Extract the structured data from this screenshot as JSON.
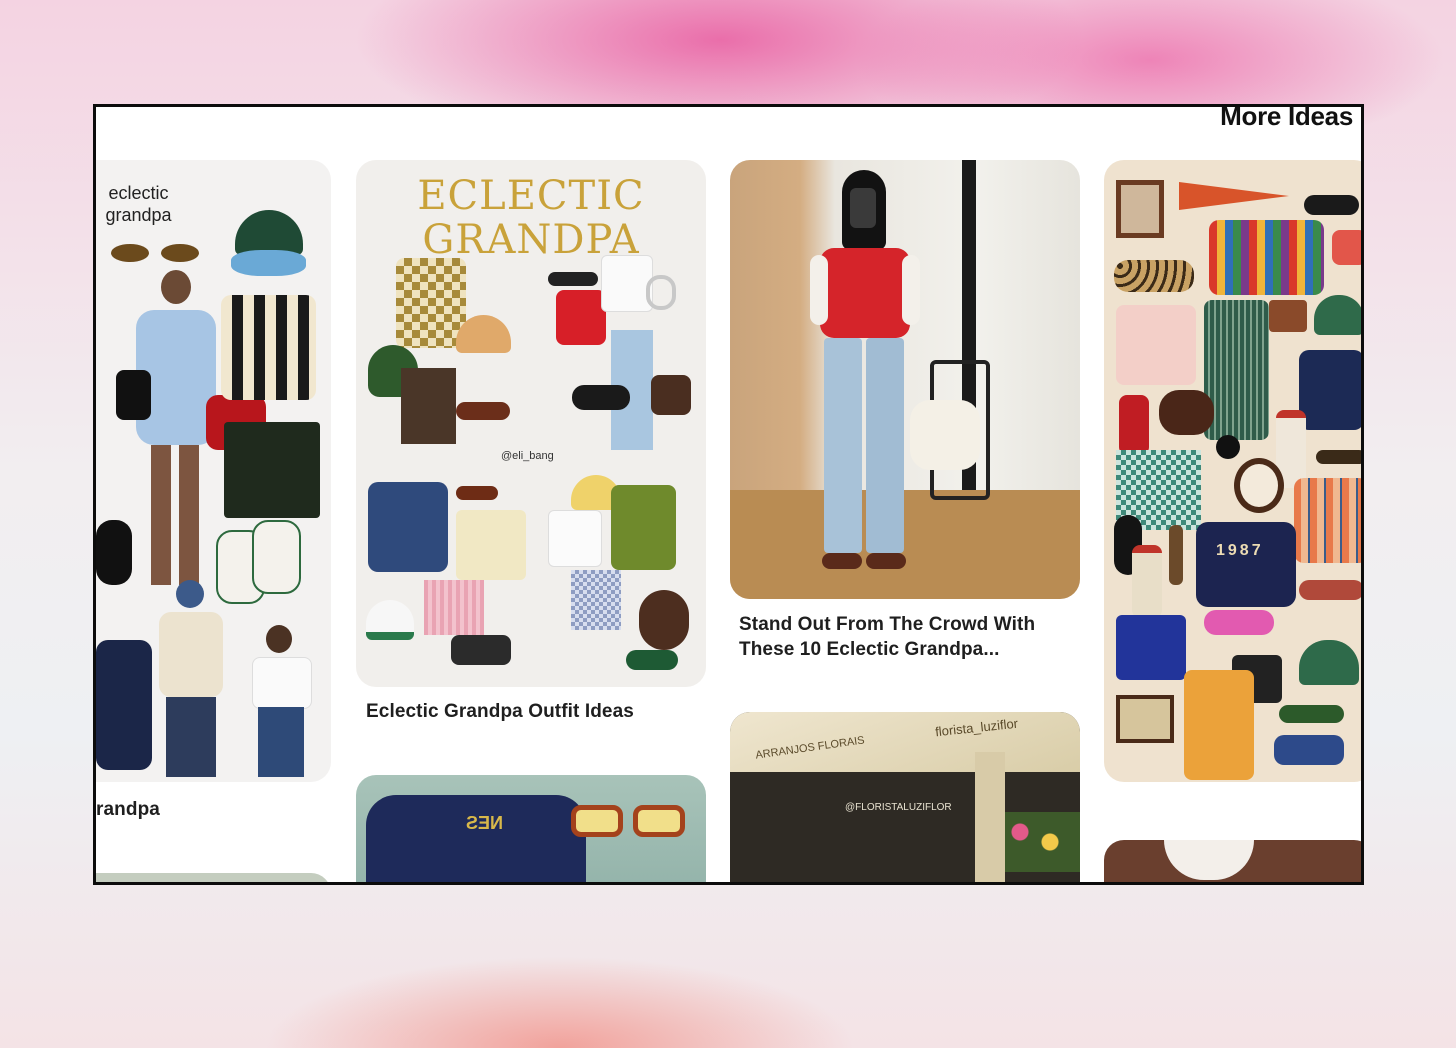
{
  "header": {
    "title": "More Ideas"
  },
  "pins": [
    {
      "title": "randpa",
      "image_text": [
        "eclectic",
        "grandpa"
      ]
    },
    {
      "title": "Eclectic Grandpa Outfit Ideas",
      "image_text": [
        "ECLECTIC",
        "GRANDPA"
      ],
      "handle": "@eli_bang"
    },
    {
      "title_line1": "Stand Out From The Crowd With",
      "title_line2": "These 10 Eclectic Grandpa..."
    },
    {
      "image_text": "1987"
    },
    {
      "image_text": "NES"
    },
    {
      "image_text": [
        "ARRANJOS FLORAIS",
        "@FLORISTALUZIFLOR",
        "florista_luziflor"
      ]
    }
  ],
  "colors": {
    "title_gold": "#c9a23a",
    "frame_border": "#0c0c0c",
    "background_pink": "#e85ca0"
  }
}
